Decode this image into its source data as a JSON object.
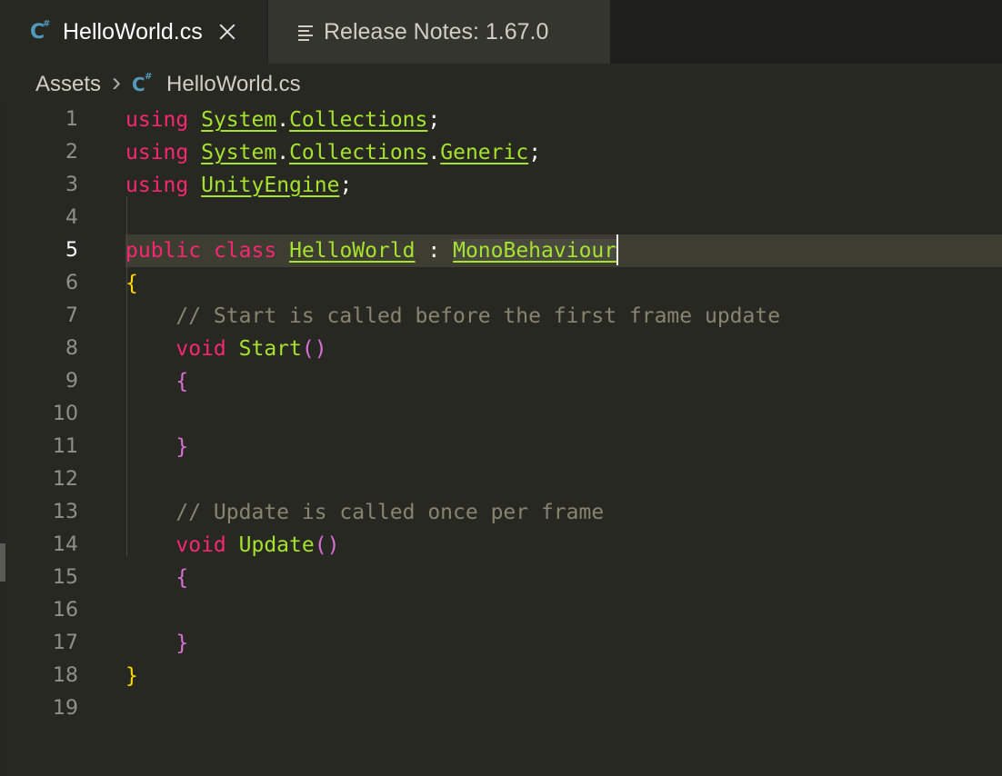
{
  "tabs": [
    {
      "label": "HelloWorld.cs",
      "icon": "csharp-file-icon",
      "active": true
    },
    {
      "label": "Release Notes: 1.67.0",
      "icon": "notes-icon",
      "active": false
    }
  ],
  "breadcrumb": {
    "folder": "Assets",
    "file": "HelloWorld.cs"
  },
  "colors": {
    "keyword": "#f92672",
    "type": "#a6e22e",
    "comment": "#88846f",
    "background": "#272822"
  },
  "editor": {
    "current_line": 5,
    "lines": [
      {
        "n": "1",
        "t": [
          [
            "kw",
            "using"
          ],
          [
            "pn",
            " "
          ],
          [
            "ty",
            "System"
          ],
          [
            "pn",
            "."
          ],
          [
            "ty",
            "Collections"
          ],
          [
            "pn",
            ";"
          ]
        ]
      },
      {
        "n": "2",
        "t": [
          [
            "kw",
            "using"
          ],
          [
            "pn",
            " "
          ],
          [
            "ty",
            "System"
          ],
          [
            "pn",
            "."
          ],
          [
            "ty",
            "Collections"
          ],
          [
            "pn",
            "."
          ],
          [
            "ty",
            "Generic"
          ],
          [
            "pn",
            ";"
          ]
        ]
      },
      {
        "n": "3",
        "t": [
          [
            "kw",
            "using"
          ],
          [
            "pn",
            " "
          ],
          [
            "ty",
            "UnityEngine"
          ],
          [
            "pn",
            ";"
          ]
        ]
      },
      {
        "n": "4",
        "t": []
      },
      {
        "n": "5",
        "t": [
          [
            "kw",
            "public"
          ],
          [
            "pn",
            " "
          ],
          [
            "kw",
            "class"
          ],
          [
            "pn",
            " "
          ],
          [
            "ty",
            "HelloWorld"
          ],
          [
            "pn",
            " : "
          ],
          [
            "ty hl-word",
            "MonoBehaviour"
          ],
          [
            "cursor",
            ""
          ]
        ]
      },
      {
        "n": "6",
        "t": [
          [
            "br-y",
            "{"
          ]
        ]
      },
      {
        "n": "7",
        "t": [
          [
            "pn",
            "    "
          ],
          [
            "cm",
            "// Start is called before the first frame update"
          ]
        ]
      },
      {
        "n": "8",
        "t": [
          [
            "pn",
            "    "
          ],
          [
            "kw",
            "void"
          ],
          [
            "pn",
            " "
          ],
          [
            "fn",
            "Start"
          ],
          [
            "br-p",
            "()"
          ]
        ]
      },
      {
        "n": "9",
        "t": [
          [
            "pn",
            "    "
          ],
          [
            "br-p",
            "{"
          ]
        ]
      },
      {
        "n": "10",
        "t": []
      },
      {
        "n": "11",
        "t": [
          [
            "pn",
            "    "
          ],
          [
            "br-p",
            "}"
          ]
        ]
      },
      {
        "n": "12",
        "t": []
      },
      {
        "n": "13",
        "t": [
          [
            "pn",
            "    "
          ],
          [
            "cm",
            "// Update is called once per frame"
          ]
        ]
      },
      {
        "n": "14",
        "t": [
          [
            "pn",
            "    "
          ],
          [
            "kw",
            "void"
          ],
          [
            "pn",
            " "
          ],
          [
            "fn",
            "Update"
          ],
          [
            "br-p",
            "()"
          ]
        ]
      },
      {
        "n": "15",
        "t": [
          [
            "pn",
            "    "
          ],
          [
            "br-p",
            "{"
          ]
        ]
      },
      {
        "n": "16",
        "t": []
      },
      {
        "n": "17",
        "t": [
          [
            "pn",
            "    "
          ],
          [
            "br-p",
            "}"
          ]
        ]
      },
      {
        "n": "18",
        "t": [
          [
            "br-y",
            "}"
          ]
        ]
      },
      {
        "n": "19",
        "t": []
      }
    ]
  }
}
